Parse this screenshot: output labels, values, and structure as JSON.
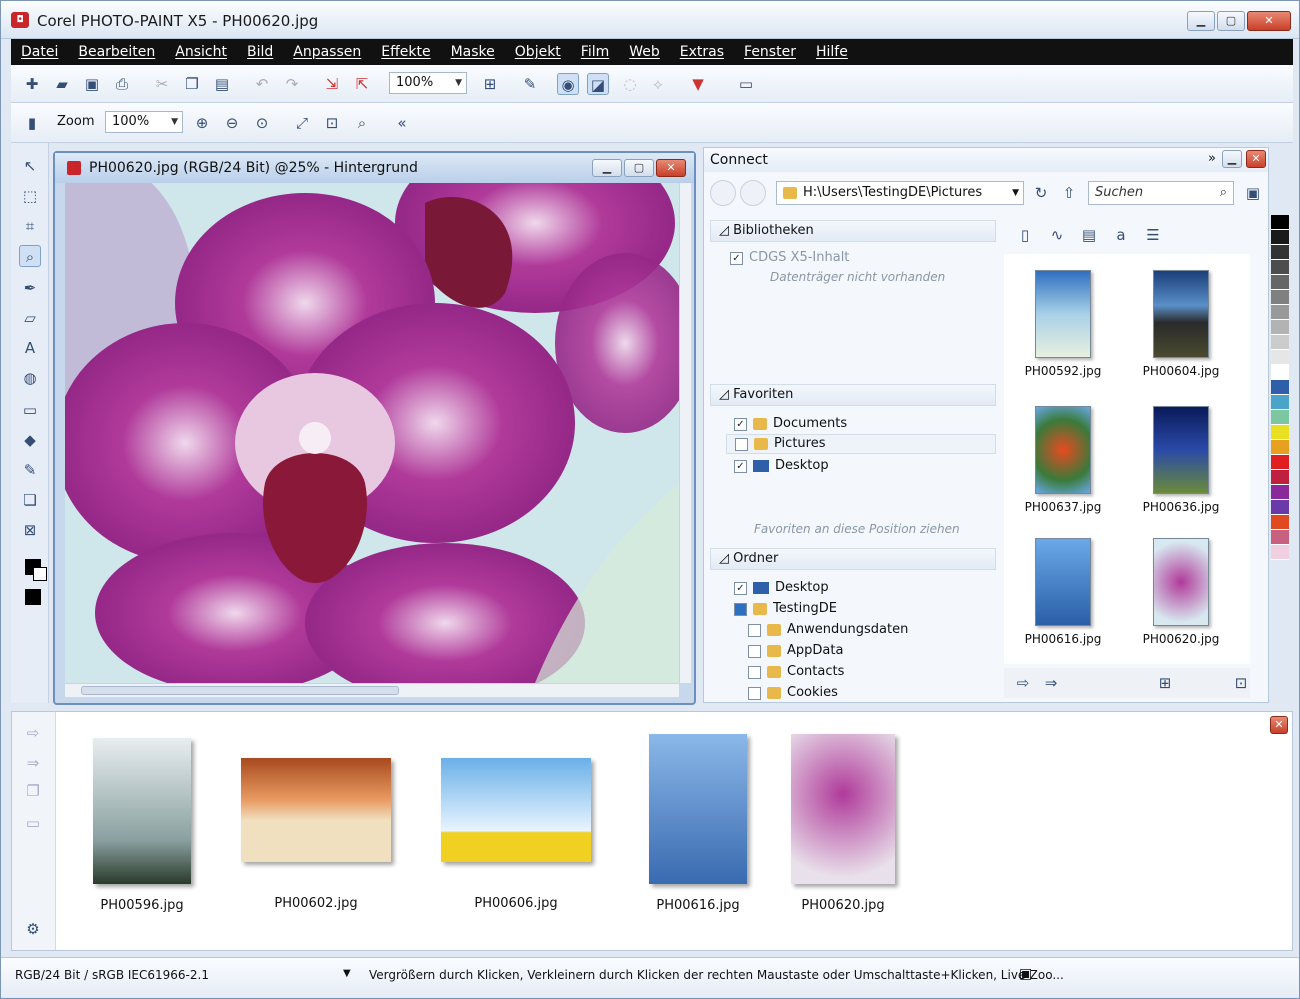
{
  "window": {
    "title": "Corel PHOTO-PAINT X5 - PH00620.jpg"
  },
  "menu": [
    "Datei",
    "Bearbeiten",
    "Ansicht",
    "Bild",
    "Anpassen",
    "Effekte",
    "Maske",
    "Objekt",
    "Film",
    "Web",
    "Extras",
    "Fenster",
    "Hilfe"
  ],
  "toolbar": {
    "zoom_combo": "100%",
    "zoom_label": "Zoom",
    "zoom_value": "100%"
  },
  "document": {
    "title": "PH00620.jpg (RGB/24 Bit) @25% - Hintergrund"
  },
  "connect": {
    "title": "Connect",
    "path": "H:\\Users\\TestingDE\\Pictures",
    "search_placeholder": "Suchen",
    "libraries": {
      "header": "Bibliotheken",
      "item": "CDGS X5-Inhalt",
      "note": "Datenträger nicht vorhanden"
    },
    "favorites": {
      "header": "Favoriten",
      "items": [
        {
          "label": "Documents",
          "checked": true
        },
        {
          "label": "Pictures",
          "checked": false
        },
        {
          "label": "Desktop",
          "checked": true
        }
      ],
      "hint": "Favoriten an diese Position ziehen"
    },
    "folders": {
      "header": "Ordner",
      "items": [
        "Desktop",
        "TestingDE",
        "Anwendungsdaten",
        "AppData",
        "Contacts",
        "Cookies"
      ]
    },
    "thumbnails": [
      "PH00592.jpg",
      "PH00604.jpg",
      "PH00637.jpg",
      "PH00636.jpg",
      "PH00616.jpg",
      "PH00620.jpg"
    ]
  },
  "tray": {
    "items": [
      "PH00596.jpg",
      "PH00602.jpg",
      "PH00606.jpg",
      "PH00616.jpg",
      "PH00620.jpg"
    ]
  },
  "status": {
    "color_profile": "RGB/24 Bit / sRGB IEC61966-2.1",
    "message": "Vergrößern durch Klicken, Verkleinern durch Klicken der rechten Maustaste oder Umschalttaste+Klicken, Live-Zoo..."
  },
  "colors": {
    "accent": "#6c8fbf",
    "close_red": "#c8402a",
    "menubar": "#111111"
  },
  "palette": [
    "#000000",
    "#1a1a1a",
    "#333333",
    "#4d4d4d",
    "#666666",
    "#808080",
    "#999999",
    "#b3b3b3",
    "#cccccc",
    "#e6e6e6",
    "#ffffff",
    "#2f5fa8",
    "#4aa3c8",
    "#7cc7a0",
    "#e8e020",
    "#e8a020",
    "#e02020",
    "#c02040",
    "#8a2a9a",
    "#6a3aa8",
    "#e04a20",
    "#c86080",
    "#f0d0e0"
  ]
}
